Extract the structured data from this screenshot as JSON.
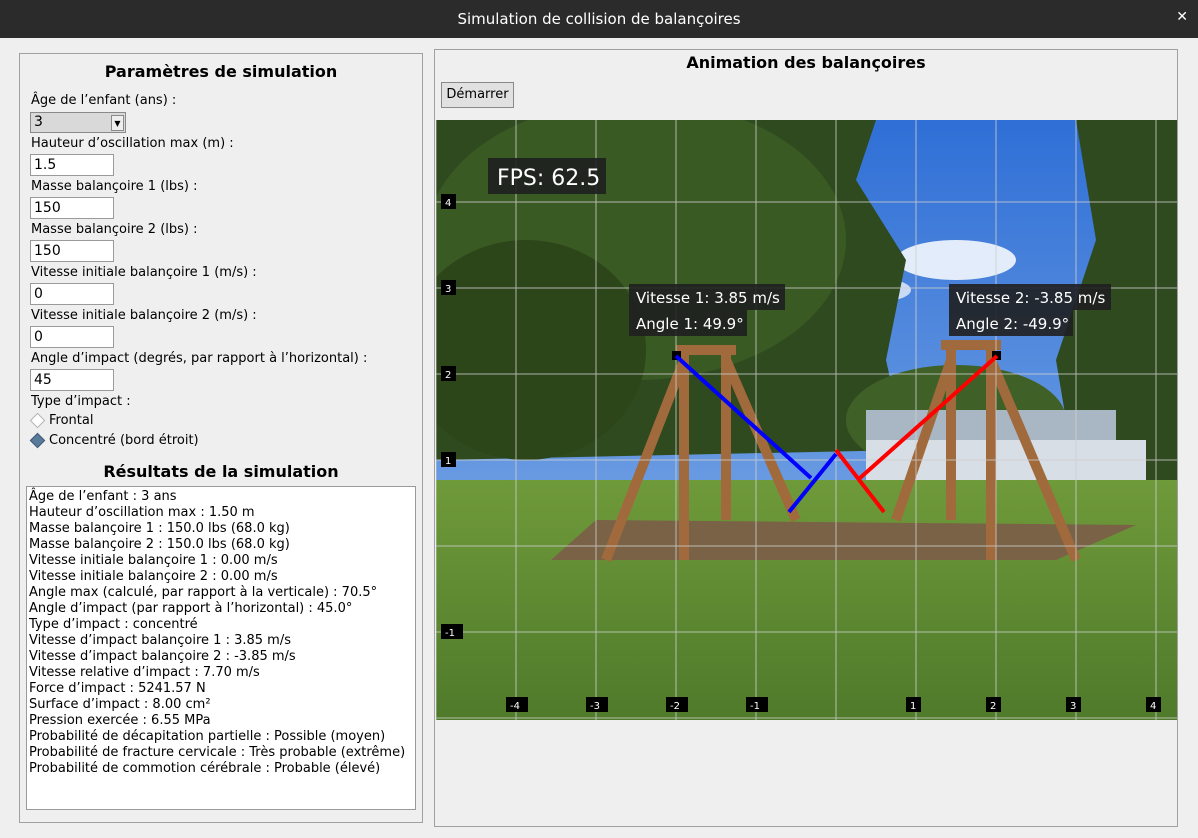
{
  "window": {
    "title": "Simulation de collision de balançoires",
    "close_glyph": "✕"
  },
  "params": {
    "title": "Paramètres de simulation",
    "age_label": "Âge de l’enfant (ans) :",
    "age_value": "3",
    "height_label": "Hauteur d’oscillation max (m) :",
    "height_value": "1.5",
    "mass1_label": "Masse balançoire 1 (lbs) :",
    "mass1_value": "150",
    "mass2_label": "Masse balançoire 2 (lbs) :",
    "mass2_value": "150",
    "vel1_label": "Vitesse initiale balançoire 1 (m/s) :",
    "vel1_value": "0",
    "vel2_label": "Vitesse initiale balançoire 2 (m/s) :",
    "vel2_value": "0",
    "angle_label": "Angle d’impact (degrés, par rapport à l’horizontal) :",
    "angle_value": "45",
    "impact_type_label": "Type d’impact :",
    "impact_frontal": "Frontal",
    "impact_concentrated": "Concentré (bord étroit)",
    "selected_impact": "concentrated"
  },
  "results": {
    "title": "Résultats de la simulation",
    "lines": [
      "Âge de l’enfant : 3 ans",
      "Hauteur d’oscillation max : 1.50 m",
      "Masse balançoire 1 : 150.0 lbs (68.0 kg)",
      "Masse balançoire 2 : 150.0 lbs (68.0 kg)",
      "Vitesse initiale balançoire 1 : 0.00 m/s",
      "Vitesse initiale balançoire 2 : 0.00 m/s",
      "Angle max (calculé, par rapport à la verticale) : 70.5°",
      "Angle d’impact (par rapport à l’horizontal) : 45.0°",
      "Type d’impact : concentré",
      "Vitesse d’impact balançoire 1 : 3.85 m/s",
      "Vitesse d’impact balançoire 2 : -3.85 m/s",
      "Vitesse relative d’impact : 7.70 m/s",
      "Force d’impact : 5241.57 N",
      "Surface d’impact : 8.00 cm²",
      "Pression exercée : 6.55 MPa",
      "Probabilité de décapitation partielle : Possible (moyen)",
      "Probabilité de fracture cervicale : Très probable (extrême)",
      "Probabilité de commotion cérébrale : Probable (élevé)"
    ]
  },
  "animation": {
    "title": "Animation des balançoires",
    "start_label": "Démarrer",
    "fps": "FPS: 62.5",
    "swing1_speed": "Vitesse 1: 3.85 m/s",
    "swing1_angle": "Angle 1: 49.9°",
    "swing2_speed": "Vitesse 2: -3.85 m/s",
    "swing2_angle": "Angle 2: -49.9°",
    "swing1_color": "#0000ff",
    "swing2_color": "#ff0000",
    "x_ticks": [
      "-4",
      "-3",
      "-2",
      "-1",
      "1",
      "2",
      "3",
      "4"
    ],
    "y_ticks": [
      "4",
      "3",
      "2",
      "1",
      "-1"
    ]
  }
}
